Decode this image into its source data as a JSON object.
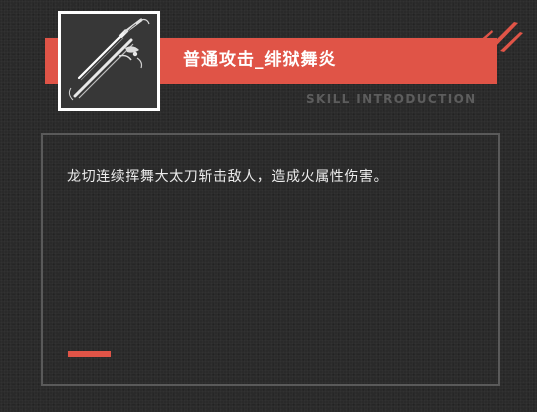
{
  "skill": {
    "title": "普通攻击_绯狱舞炎",
    "subtitle": "SKILL INTRODUCTION",
    "description": "龙切连续挥舞大太刀斩击敌人，造成火属性伤害。",
    "icon": "sword-icon"
  },
  "colors": {
    "accent": "#e05447",
    "background": "#2a2a2a",
    "border": "#5a5a5a",
    "text": "#ececec",
    "subtitle": "#5d5d5d"
  }
}
